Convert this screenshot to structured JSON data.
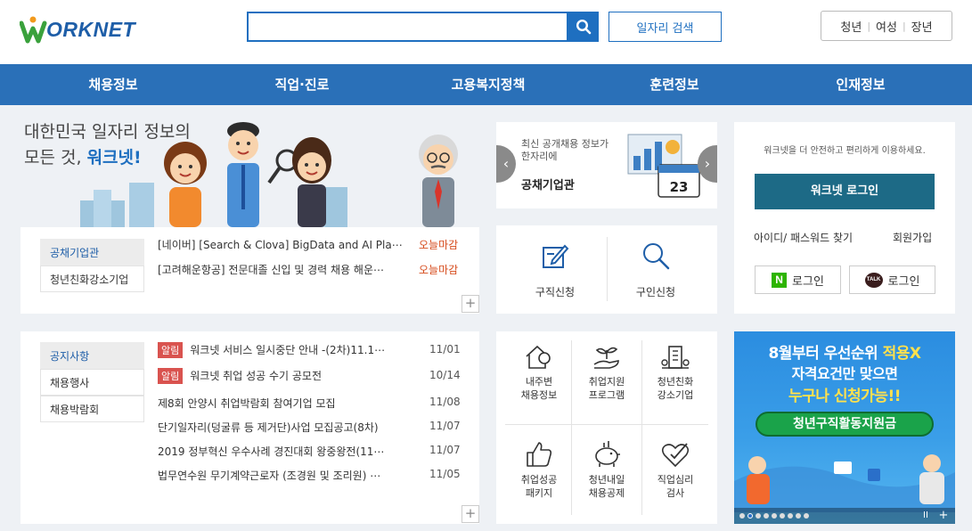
{
  "header": {
    "logo_text": "ORKNET",
    "search_placeholder": "",
    "job_search_label": "일자리 검색",
    "audience": [
      "청년",
      "여성",
      "장년"
    ]
  },
  "nav": [
    "채용정보",
    "직업·진로",
    "고용복지정책",
    "훈련정보",
    "인재정보"
  ],
  "hero": {
    "line1": "대한민국 일자리 정보의",
    "line2_prefix": "모든 것,",
    "line2_brand": "워크넷!"
  },
  "jobs_box": {
    "tabs": [
      "공채기업관",
      "청년친화강소기업"
    ],
    "rows": [
      {
        "text": "[네이버] [Search & Clova] BigData and AI Pla⋯",
        "status": "오늘마감"
      },
      {
        "text": "[고려해운항공] 전문대졸 신입 및 경력 채용 해운⋯",
        "status": "오늘마감"
      }
    ],
    "more": "+"
  },
  "slide": {
    "line1": "최신 공개채용 정보가",
    "line2": "한자리에",
    "title": "공채기업관",
    "calendar_day": "23"
  },
  "services": [
    {
      "label": "구직신청",
      "icon": "pencil-note-icon"
    },
    {
      "label": "구인신청",
      "icon": "magnifier-icon"
    }
  ],
  "login": {
    "notice": "워크넷을 더 안전하고 편리하게 이용하세요.",
    "button": "워크넷 로그인",
    "find": "아이디/ 패스워드 찾기",
    "join": "회원가입",
    "naver_mark": "N",
    "naver_label": "로그인",
    "kakao_mark": "TALK",
    "kakao_label": "로그인"
  },
  "notice_box": {
    "tabs": [
      "공지사항",
      "채용행사",
      "채용박람회"
    ],
    "badge": "알림",
    "rows": [
      {
        "badge": true,
        "text": "워크넷 서비스 일시중단 안내 -(2차)11.1⋯",
        "date": "11/01"
      },
      {
        "badge": true,
        "text": "워크넷 취업 성공 수기 공모전",
        "date": "10/14"
      },
      {
        "badge": false,
        "text": "제8회 안양시 취업박람회 참여기업 모집",
        "date": "11/08"
      },
      {
        "badge": false,
        "text": "단기일자리(덩굴류 등 제거단)사업 모집공고(8차)",
        "date": "11/07"
      },
      {
        "badge": false,
        "text": "2019 정부혁신 우수사례 경진대회 왕중왕전(11⋯",
        "date": "11/07"
      },
      {
        "badge": false,
        "text": "법무연수원 무기계약근로자 (조경원 및 조리원) ⋯",
        "date": "11/05"
      }
    ],
    "more": "+"
  },
  "quick_links": [
    {
      "l1": "내주변",
      "l2": "채용정보",
      "icon": "house-location-icon"
    },
    {
      "l1": "취업지원",
      "l2": "프로그램",
      "icon": "sprout-hand-icon"
    },
    {
      "l1": "청년친화",
      "l2": "강소기업",
      "icon": "building-icon"
    },
    {
      "l1": "취업성공",
      "l2": "패키지",
      "icon": "thumbs-up-icon"
    },
    {
      "l1": "청년내일",
      "l2": "채용공제",
      "icon": "piggy-bank-icon"
    },
    {
      "l1": "직업심리",
      "l2": "검사",
      "icon": "heart-check-icon"
    }
  ],
  "banner": {
    "line1_a": "8월부터 우선순위 ",
    "line1_b": "적용X",
    "line2": "자격요건만 맞으면",
    "line3": "누구나 신청가능!!",
    "badge": "청년구직활동지원금",
    "pause": "II",
    "plus": "+"
  },
  "colors": {
    "brand": "#1e6fc0",
    "nav": "#2a70b8",
    "login": "#1d6a86",
    "deadline": "#d64b1c",
    "badge": "#d9534f",
    "banner_badge": "#1aa34a"
  }
}
